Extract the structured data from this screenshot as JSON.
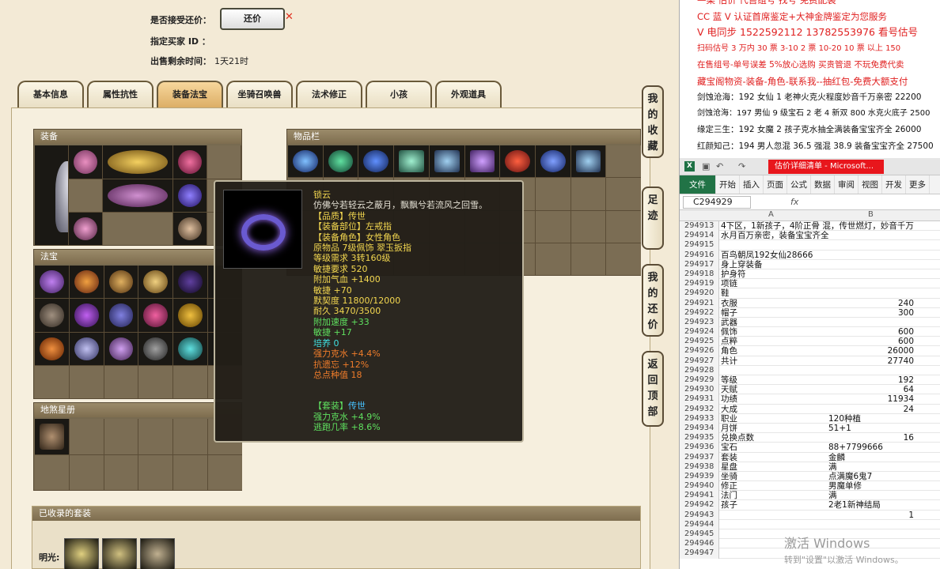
{
  "sale_info": {
    "counter_offer_label": "是否接受还价：",
    "counter_offer_button": "还价",
    "buyer_id_label": "指定买家 ID ：",
    "time_left_label": "出售剩余时间：",
    "time_left_value": "1天21时"
  },
  "tabs": [
    {
      "label": "基本信息",
      "active": false
    },
    {
      "label": "属性抗性",
      "active": false
    },
    {
      "label": "装备法宝",
      "active": true
    },
    {
      "label": "坐骑召唤兽",
      "active": false
    },
    {
      "label": "法术修正",
      "active": false
    },
    {
      "label": "小孩",
      "active": false
    },
    {
      "label": "外观道具",
      "active": false
    }
  ],
  "sections": {
    "equipment": "装备",
    "inventory": "物品栏",
    "treasure": "法宝",
    "star_book": "地煞星册",
    "collected_sets": "已收录的套装",
    "set_row_label": "明光:"
  },
  "tooltip": {
    "name": "锁云",
    "desc": "仿佛兮若轻云之蔽月，飘飘兮若流风之回雪。",
    "quality": "【品质】传世",
    "slot": "【装备部位】左戒指",
    "role": "【装备角色】女性角色",
    "origin": "原物品 7级佩饰 翠玉扳指",
    "level": "等级需求 3转160级",
    "agility_req": "敏捷要求 520",
    "hp": "附加气血 +1400",
    "agility": "敏捷 +70",
    "tacit": "默契度 11800/12000",
    "durability": "耐久 3470/3500",
    "speed": "附加速度 +33",
    "agility2": "敏捷 +17",
    "cultivate": "培养 0",
    "water_strength": "强力克水 +4.4%",
    "forget_resist": "抗遗忘 +12%",
    "total_value": "总点种值 18",
    "set_label": "【套装】",
    "set_quality": "传世",
    "set_water": "强力克水 +4.9%",
    "set_escape": "逃跑几率 +8.6%"
  },
  "side_buttons": [
    "我的收藏",
    "足迹",
    "我的还价",
    "返回顶部"
  ],
  "ad": {
    "line0": "—梁 估价 代售组号 找号 免费配装",
    "line1": "CC 蓝 V 认证首席鉴定+大神金牌鉴定为您服务",
    "line2": "V 电同步 1522592112 13782553976 看号估号",
    "line3": "扫码估号 3 万内 30 票 3-10 2 票 10-20 10 票 以上 150",
    "line4": "在售组号-单号误差 5%放心选购 买贵管退 不玩免费代卖",
    "line5": "藏宝阁物资-装备-角色-联系我--抽红包-免费大额支付",
    "line6": "剑蚀沧海：192 女仙 1 老神火克火程度妙音千万亲密 22200",
    "line7": "剑蚀沧海：197 男仙 9 级宝石 2 老 4 新双 800 水克火底子 2500",
    "line8": "缘定三生：192 女魔 2 孩子克水抽全满装备宝宝齐全 26000",
    "line9": "红颜知己：194 男人忽混 36.5 强混 38.9 装备宝宝齐全 27500"
  },
  "excel": {
    "doc_title": "估价详细清单 - Microsoft...",
    "ribbon": [
      "文件",
      "开始",
      "插入",
      "页面",
      "公式",
      "数据",
      "审阅",
      "视图",
      "开发",
      "更多"
    ],
    "name_box": "C294929",
    "fx": "fx",
    "col_a": "A",
    "col_b": "B",
    "rows": [
      {
        "n": "294913",
        "a": "4下区，1新孩子，4阶正骨 混，传世燃灯，妙音千万",
        "b": ""
      },
      {
        "n": "294914",
        "a": "水月百万亲密，装备宝宝齐全",
        "b": ""
      },
      {
        "n": "294915",
        "a": "",
        "b": ""
      },
      {
        "n": "294916",
        "a": "百鸟朝凤192女仙28666",
        "b": ""
      },
      {
        "n": "294917",
        "a": "身上穿装备",
        "b": ""
      },
      {
        "n": "294918",
        "a": "护身符",
        "b": ""
      },
      {
        "n": "294919",
        "a": "项链",
        "b": ""
      },
      {
        "n": "294920",
        "a": "鞋",
        "b": ""
      },
      {
        "n": "294921",
        "a": "衣服",
        "b": "240"
      },
      {
        "n": "294922",
        "a": "帽子",
        "b": "300"
      },
      {
        "n": "294923",
        "a": "武器",
        "b": ""
      },
      {
        "n": "294924",
        "a": "佩饰",
        "b": "600"
      },
      {
        "n": "294925",
        "a": "点粹",
        "b": "600"
      },
      {
        "n": "294926",
        "a": "角色",
        "b": "26000"
      },
      {
        "n": "294927",
        "a": "共计",
        "b": "27740"
      },
      {
        "n": "294928",
        "a": "",
        "b": ""
      },
      {
        "n": "294929",
        "a": "等级",
        "b": "192"
      },
      {
        "n": "294930",
        "a": "天赋",
        "b": "64"
      },
      {
        "n": "294931",
        "a": "功绩",
        "b": "11934"
      },
      {
        "n": "294932",
        "a": "大成",
        "b": "24"
      },
      {
        "n": "294933",
        "a": "职业",
        "b": "120种植"
      },
      {
        "n": "294934",
        "a": "月饼",
        "b": "51+1"
      },
      {
        "n": "294935",
        "a": "兑换点数",
        "b": "16"
      },
      {
        "n": "294936",
        "a": "宝石",
        "b": "88+7799666"
      },
      {
        "n": "294937",
        "a": "套装",
        "b": "金麟"
      },
      {
        "n": "294938",
        "a": "星盘",
        "b": "满"
      },
      {
        "n": "294939",
        "a": "坐骑",
        "b": "点满魔6鬼7"
      },
      {
        "n": "294940",
        "a": "修正",
        "b": "男魔单修"
      },
      {
        "n": "294941",
        "a": "法门",
        "b": "满"
      },
      {
        "n": "294942",
        "a": "孩子",
        "b": "2老1新神结局"
      },
      {
        "n": "294943",
        "a": "",
        "b": "1"
      },
      {
        "n": "294944",
        "a": "",
        "b": ""
      },
      {
        "n": "294945",
        "a": "",
        "b": ""
      },
      {
        "n": "294946",
        "a": "",
        "b": ""
      },
      {
        "n": "294947",
        "a": "",
        "b": ""
      }
    ],
    "watermark1": "激活 Windows",
    "watermark2": "转到\"设置\"以激活 Windows。"
  }
}
